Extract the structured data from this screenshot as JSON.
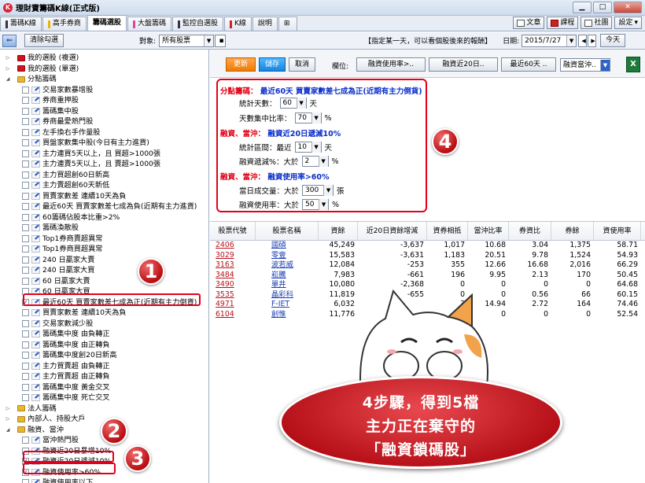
{
  "window": {
    "title": "理財寶籌碼K線(正式版)",
    "buttons": [
      "▁",
      "□",
      "✕"
    ]
  },
  "tabs": [
    {
      "label": "籌碼K線",
      "bar": "dark"
    },
    {
      "label": "高手券商",
      "bar": "yellow"
    },
    {
      "label": "籌碼選股",
      "bar": "",
      "active": true
    },
    {
      "label": "大盤籌碼",
      "bar": "pink"
    },
    {
      "label": "監控自選股",
      "bar": "dark"
    },
    {
      "label": "K線",
      "bar": "red"
    },
    {
      "label": "說明",
      "bar": ""
    },
    {
      "label": "",
      "bar": ""
    }
  ],
  "top_right": {
    "article": "文章",
    "course": "課程",
    "community": "社團",
    "settings": "設定"
  },
  "toolbar": {
    "back": "⇐",
    "clear": "清除勾選",
    "target_label": "對象:",
    "target_value": "所有股票",
    "hint": "【指定某一天，可以看個股後來的報酬】",
    "date_label": "日期:",
    "date_value": "2015/7/27",
    "today": "今天"
  },
  "tree": [
    {
      "indent": 0,
      "tri": "▷",
      "icon": "folder-red",
      "label": "我的選股 (複選)"
    },
    {
      "indent": 0,
      "tri": "▷",
      "icon": "folder-red",
      "label": "我的選股 (單選)"
    },
    {
      "indent": 0,
      "tri": "◢",
      "icon": "folder",
      "label": "分點籌碼"
    },
    {
      "indent": 1,
      "icon": "item",
      "label": "交易家數暴增股"
    },
    {
      "indent": 1,
      "icon": "item",
      "label": "券商重押股"
    },
    {
      "indent": 1,
      "icon": "item",
      "label": "籌碼集中股"
    },
    {
      "indent": 1,
      "icon": "item",
      "label": "券商最愛熱門股"
    },
    {
      "indent": 1,
      "icon": "item",
      "label": "左手換右手作量股"
    },
    {
      "indent": 1,
      "icon": "item",
      "label": "買盤家數集中股(今日有主力進貨)"
    },
    {
      "indent": 1,
      "icon": "item",
      "label": "主力連買5天以上，且 買超>1000張"
    },
    {
      "indent": 1,
      "icon": "item",
      "label": "主力連賣5天以上，且 賣超>1000張"
    },
    {
      "indent": 1,
      "icon": "item",
      "label": "主力買超創60日新高"
    },
    {
      "indent": 1,
      "icon": "item",
      "label": "主力賣超創60天新低"
    },
    {
      "indent": 1,
      "icon": "item",
      "label": "買賣家數差 連續10天為負"
    },
    {
      "indent": 1,
      "icon": "item",
      "label": "最近60天 買賣家數差七成為負(近期有主力進貨)"
    },
    {
      "indent": 1,
      "icon": "item",
      "label": "60籌碼佔股本比重>2%"
    },
    {
      "indent": 1,
      "icon": "item",
      "label": "籌碼渙散股"
    },
    {
      "indent": 1,
      "icon": "item",
      "label": "Top1券商賣超異常"
    },
    {
      "indent": 1,
      "icon": "item",
      "label": "Top1券商買超異常"
    },
    {
      "indent": 1,
      "icon": "item",
      "label": "240 日贏家大賣"
    },
    {
      "indent": 1,
      "icon": "item",
      "label": "240 日贏家大買"
    },
    {
      "indent": 1,
      "icon": "item",
      "label": "60 日贏家大賣"
    },
    {
      "indent": 1,
      "icon": "item",
      "label": "60 日贏家大買"
    },
    {
      "indent": 1,
      "icon": "item",
      "label": "最近60天 買賣家數差七成為正(近期有主力倒貨)",
      "checked": true
    },
    {
      "indent": 1,
      "icon": "item",
      "label": "買賣家數差 連續10天為負"
    },
    {
      "indent": 1,
      "icon": "item",
      "label": "交易家數減少股"
    },
    {
      "indent": 1,
      "icon": "item",
      "label": "籌碼集中度 由負轉正"
    },
    {
      "indent": 1,
      "icon": "item",
      "label": "籌碼集中度 由正轉負"
    },
    {
      "indent": 1,
      "icon": "item",
      "label": "籌碼集中度創20日新高"
    },
    {
      "indent": 1,
      "icon": "item",
      "label": "主力買賣超 由負轉正"
    },
    {
      "indent": 1,
      "icon": "item",
      "label": "主力買賣超 由正轉負"
    },
    {
      "indent": 1,
      "icon": "item",
      "label": "籌碼集中度 黃金交叉"
    },
    {
      "indent": 1,
      "icon": "item",
      "label": "籌碼集中度 死亡交叉"
    },
    {
      "indent": 0,
      "tri": "▷",
      "icon": "folder",
      "label": "法人籌碼"
    },
    {
      "indent": 0,
      "tri": "▷",
      "icon": "folder",
      "label": "內部人、持股大戶"
    },
    {
      "indent": 0,
      "tri": "◢",
      "icon": "folder",
      "label": "融資、當沖"
    },
    {
      "indent": 1,
      "icon": "item",
      "label": "當沖熱門股"
    },
    {
      "indent": 1,
      "icon": "item",
      "label": "融資近20日暴增10%"
    },
    {
      "indent": 1,
      "icon": "item",
      "label": "融資近20日遞減10%",
      "checked": true
    },
    {
      "indent": 1,
      "icon": "item",
      "label": "融資使用率>60%",
      "checked": true
    },
    {
      "indent": 1,
      "icon": "item",
      "label": "融資使用率以下..."
    }
  ],
  "badges": [
    "1",
    "2",
    "3",
    "4"
  ],
  "right_toolbar": {
    "update": "更新",
    "save": "儲存",
    "cancel": "取消",
    "columns_label": "欄位:",
    "col1": "融資使用率>..",
    "col2": "融資近20日..",
    "col3": "最近60天 ..",
    "col4": "融資當沖..",
    "excel": "X"
  },
  "conditions": {
    "g1_title_red": "分點籌碼：",
    "g1_title_blue": "最近60天 買賣家數差七成為正(近期有主力倒貨)",
    "g1_l1_pre": "統計天數：",
    "g1_l1_val": "60",
    "g1_l1_post": "天",
    "g1_l2_pre": "天數集中比率：",
    "g1_l2_val": "70",
    "g1_l2_post": "%",
    "g2_title_red": "融資、當沖：",
    "g2_title_blue": "融資近20日遞減10%",
    "g2_l1_pre": "統計區間：最近",
    "g2_l1_val": "10",
    "g2_l1_post": "天",
    "g2_l2_pre": "融資遞減%：大於",
    "g2_l2_val": "2",
    "g2_l2_post": "%",
    "g3_title_red": "融資、當沖：",
    "g3_title_blue": "融資使用率>60%",
    "g3_l1_pre": "當日成交量：大於",
    "g3_l1_val": "300",
    "g3_l1_post": "張",
    "g3_l2_pre": "融資使用率：大於",
    "g3_l2_val": "50",
    "g3_l2_post": "%"
  },
  "table": {
    "columns": [
      "股票代號",
      "股票名稱",
      "資餘",
      "近20日資餘增減",
      "資券相抵",
      "當沖比率",
      "券資比",
      "券餘",
      "資使用率"
    ],
    "rows": [
      [
        "2406",
        "國碩",
        "45,249",
        "-3,637",
        "1,017",
        "10.68",
        "3.04",
        "1,375",
        "58.71"
      ],
      [
        "3029",
        "零壹",
        "15,583",
        "-3,631",
        "1,183",
        "20.51",
        "9.78",
        "1,524",
        "54.93"
      ],
      [
        "3163",
        "波若威",
        "12,084",
        "-253",
        "355",
        "12.66",
        "16.68",
        "2,016",
        "66.29"
      ],
      [
        "3484",
        "崧騰",
        "7,983",
        "-661",
        "196",
        "9.95",
        "2.13",
        "170",
        "50.45"
      ],
      [
        "3490",
        "單井",
        "10,080",
        "-2,368",
        "0",
        "0",
        "0",
        "0",
        "64.68"
      ],
      [
        "3535",
        "晶彩科",
        "11,819",
        "-655",
        "0",
        "0",
        "0.56",
        "66",
        "60.15"
      ],
      [
        "4971",
        "F-IET",
        "6,032",
        "",
        "3",
        "14.94",
        "2.72",
        "164",
        "74.46"
      ],
      [
        "6104",
        "創惟",
        "11,776",
        "",
        "0",
        "0",
        "0",
        "0",
        "52.54"
      ]
    ]
  },
  "banner": {
    "line1": "4步驟，得到5檔",
    "line2": "主力正在棄守的",
    "line3": "「融資鎖碼股」"
  }
}
